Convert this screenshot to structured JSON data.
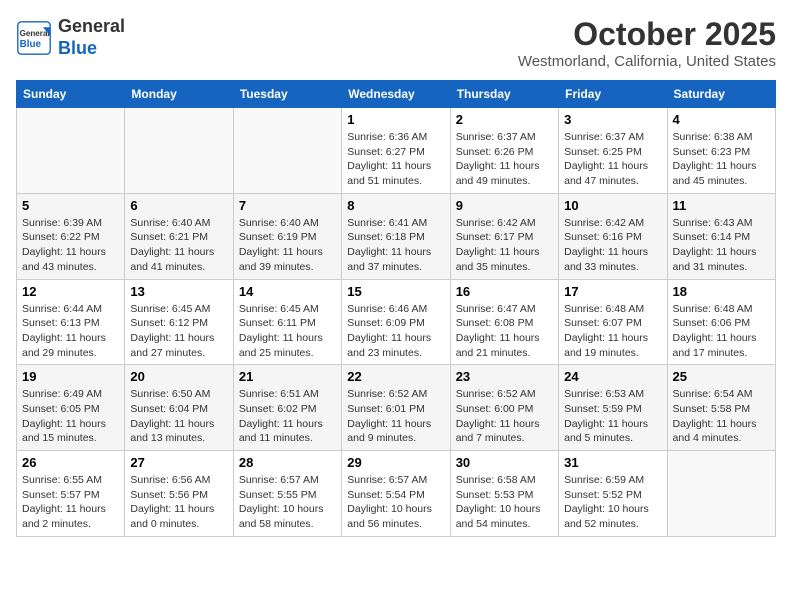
{
  "header": {
    "logo_general": "General",
    "logo_blue": "Blue",
    "month": "October 2025",
    "location": "Westmorland, California, United States"
  },
  "days_of_week": [
    "Sunday",
    "Monday",
    "Tuesday",
    "Wednesday",
    "Thursday",
    "Friday",
    "Saturday"
  ],
  "weeks": [
    [
      {
        "day": "",
        "info": ""
      },
      {
        "day": "",
        "info": ""
      },
      {
        "day": "",
        "info": ""
      },
      {
        "day": "1",
        "info": "Sunrise: 6:36 AM\nSunset: 6:27 PM\nDaylight: 11 hours\nand 51 minutes."
      },
      {
        "day": "2",
        "info": "Sunrise: 6:37 AM\nSunset: 6:26 PM\nDaylight: 11 hours\nand 49 minutes."
      },
      {
        "day": "3",
        "info": "Sunrise: 6:37 AM\nSunset: 6:25 PM\nDaylight: 11 hours\nand 47 minutes."
      },
      {
        "day": "4",
        "info": "Sunrise: 6:38 AM\nSunset: 6:23 PM\nDaylight: 11 hours\nand 45 minutes."
      }
    ],
    [
      {
        "day": "5",
        "info": "Sunrise: 6:39 AM\nSunset: 6:22 PM\nDaylight: 11 hours\nand 43 minutes."
      },
      {
        "day": "6",
        "info": "Sunrise: 6:40 AM\nSunset: 6:21 PM\nDaylight: 11 hours\nand 41 minutes."
      },
      {
        "day": "7",
        "info": "Sunrise: 6:40 AM\nSunset: 6:19 PM\nDaylight: 11 hours\nand 39 minutes."
      },
      {
        "day": "8",
        "info": "Sunrise: 6:41 AM\nSunset: 6:18 PM\nDaylight: 11 hours\nand 37 minutes."
      },
      {
        "day": "9",
        "info": "Sunrise: 6:42 AM\nSunset: 6:17 PM\nDaylight: 11 hours\nand 35 minutes."
      },
      {
        "day": "10",
        "info": "Sunrise: 6:42 AM\nSunset: 6:16 PM\nDaylight: 11 hours\nand 33 minutes."
      },
      {
        "day": "11",
        "info": "Sunrise: 6:43 AM\nSunset: 6:14 PM\nDaylight: 11 hours\nand 31 minutes."
      }
    ],
    [
      {
        "day": "12",
        "info": "Sunrise: 6:44 AM\nSunset: 6:13 PM\nDaylight: 11 hours\nand 29 minutes."
      },
      {
        "day": "13",
        "info": "Sunrise: 6:45 AM\nSunset: 6:12 PM\nDaylight: 11 hours\nand 27 minutes."
      },
      {
        "day": "14",
        "info": "Sunrise: 6:45 AM\nSunset: 6:11 PM\nDaylight: 11 hours\nand 25 minutes."
      },
      {
        "day": "15",
        "info": "Sunrise: 6:46 AM\nSunset: 6:09 PM\nDaylight: 11 hours\nand 23 minutes."
      },
      {
        "day": "16",
        "info": "Sunrise: 6:47 AM\nSunset: 6:08 PM\nDaylight: 11 hours\nand 21 minutes."
      },
      {
        "day": "17",
        "info": "Sunrise: 6:48 AM\nSunset: 6:07 PM\nDaylight: 11 hours\nand 19 minutes."
      },
      {
        "day": "18",
        "info": "Sunrise: 6:48 AM\nSunset: 6:06 PM\nDaylight: 11 hours\nand 17 minutes."
      }
    ],
    [
      {
        "day": "19",
        "info": "Sunrise: 6:49 AM\nSunset: 6:05 PM\nDaylight: 11 hours\nand 15 minutes."
      },
      {
        "day": "20",
        "info": "Sunrise: 6:50 AM\nSunset: 6:04 PM\nDaylight: 11 hours\nand 13 minutes."
      },
      {
        "day": "21",
        "info": "Sunrise: 6:51 AM\nSunset: 6:02 PM\nDaylight: 11 hours\nand 11 minutes."
      },
      {
        "day": "22",
        "info": "Sunrise: 6:52 AM\nSunset: 6:01 PM\nDaylight: 11 hours\nand 9 minutes."
      },
      {
        "day": "23",
        "info": "Sunrise: 6:52 AM\nSunset: 6:00 PM\nDaylight: 11 hours\nand 7 minutes."
      },
      {
        "day": "24",
        "info": "Sunrise: 6:53 AM\nSunset: 5:59 PM\nDaylight: 11 hours\nand 5 minutes."
      },
      {
        "day": "25",
        "info": "Sunrise: 6:54 AM\nSunset: 5:58 PM\nDaylight: 11 hours\nand 4 minutes."
      }
    ],
    [
      {
        "day": "26",
        "info": "Sunrise: 6:55 AM\nSunset: 5:57 PM\nDaylight: 11 hours\nand 2 minutes."
      },
      {
        "day": "27",
        "info": "Sunrise: 6:56 AM\nSunset: 5:56 PM\nDaylight: 11 hours\nand 0 minutes."
      },
      {
        "day": "28",
        "info": "Sunrise: 6:57 AM\nSunset: 5:55 PM\nDaylight: 10 hours\nand 58 minutes."
      },
      {
        "day": "29",
        "info": "Sunrise: 6:57 AM\nSunset: 5:54 PM\nDaylight: 10 hours\nand 56 minutes."
      },
      {
        "day": "30",
        "info": "Sunrise: 6:58 AM\nSunset: 5:53 PM\nDaylight: 10 hours\nand 54 minutes."
      },
      {
        "day": "31",
        "info": "Sunrise: 6:59 AM\nSunset: 5:52 PM\nDaylight: 10 hours\nand 52 minutes."
      },
      {
        "day": "",
        "info": ""
      }
    ]
  ]
}
